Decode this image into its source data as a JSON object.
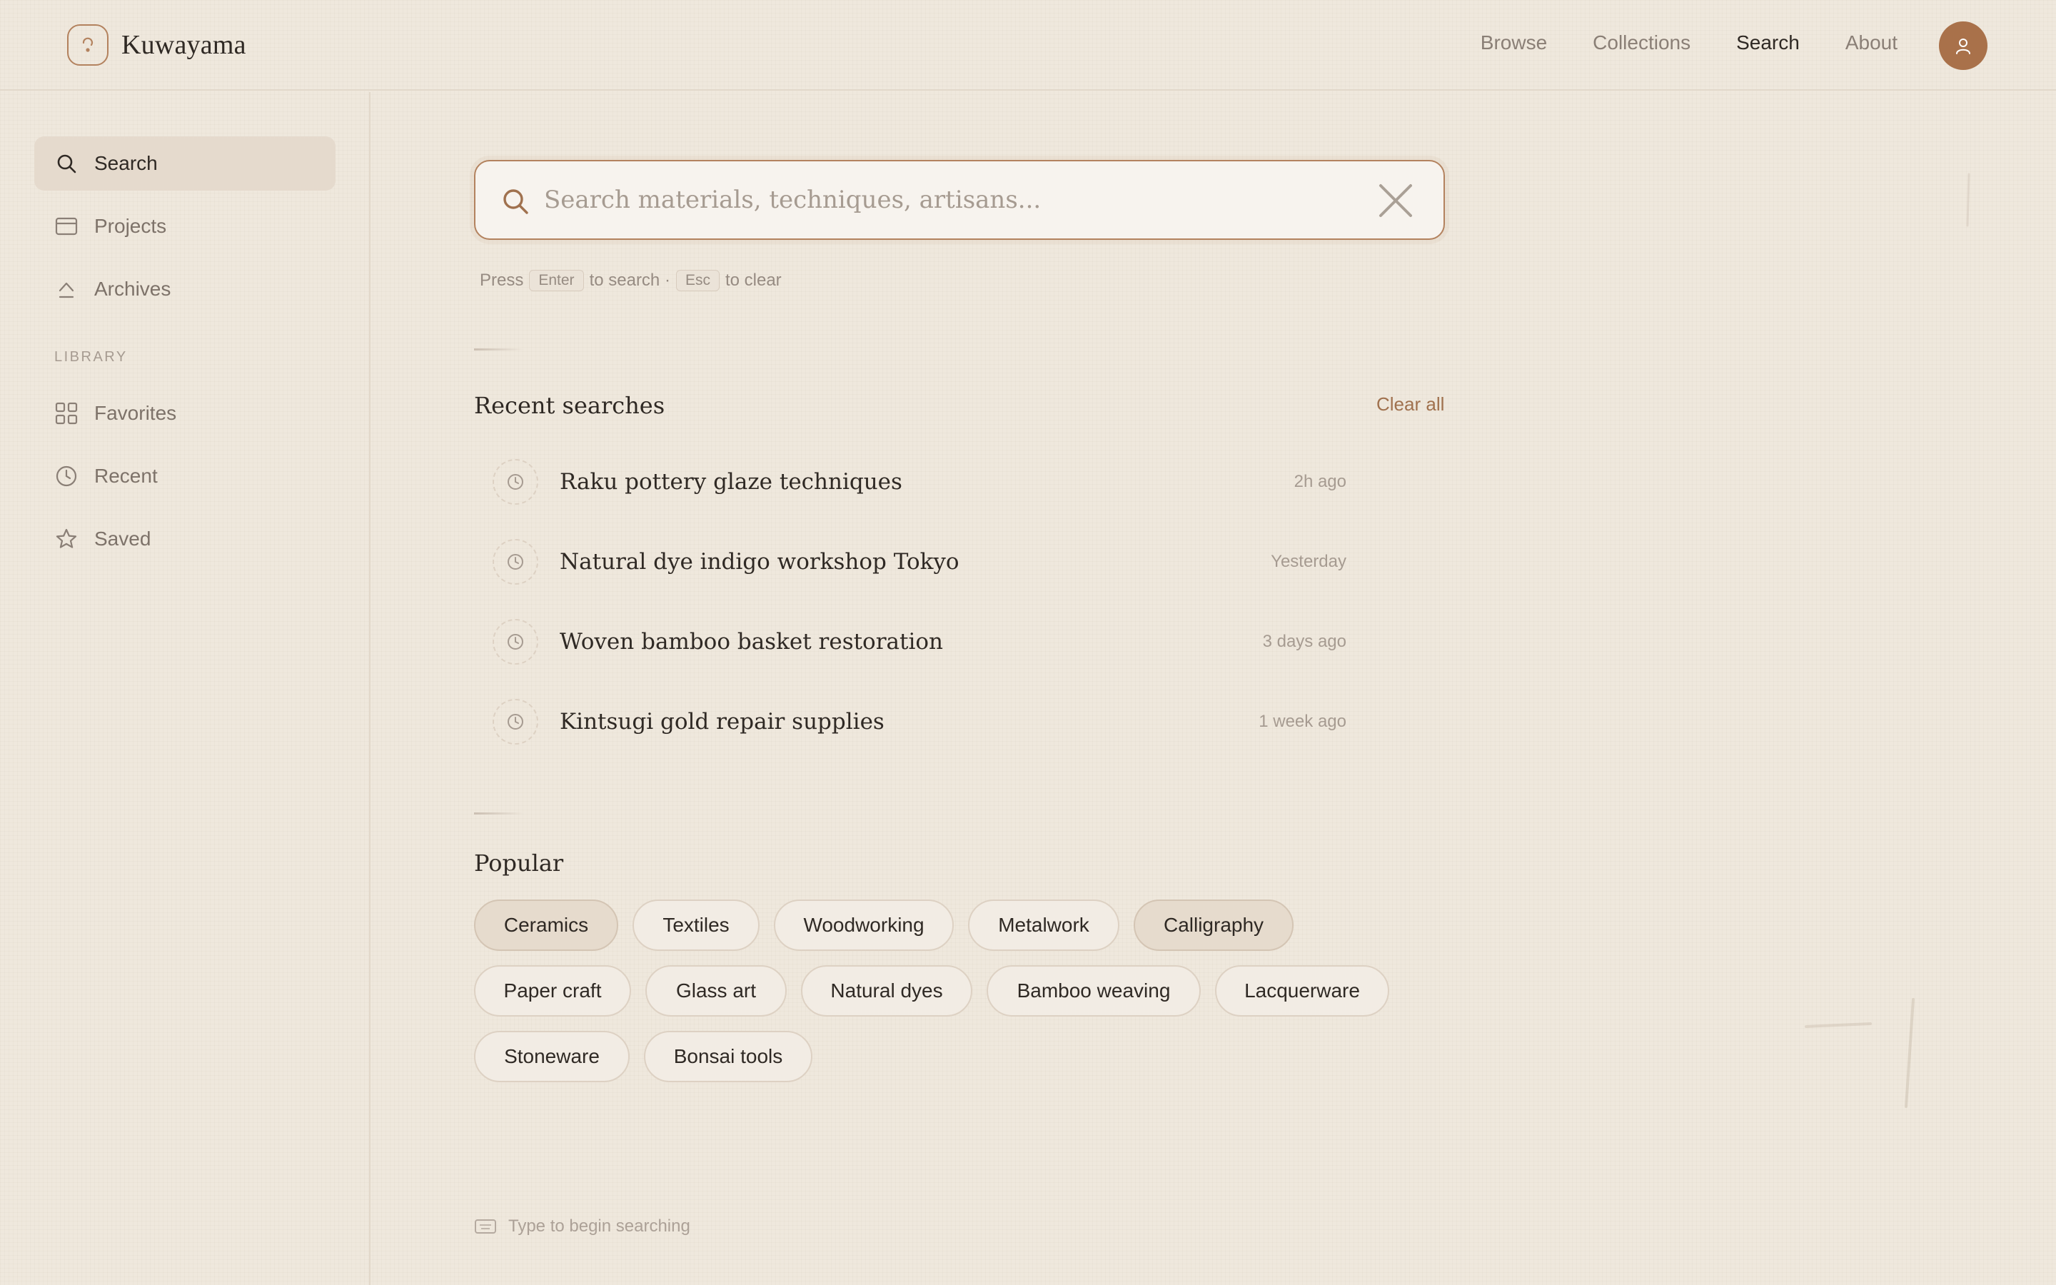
{
  "app": {
    "name": "Kuwayama"
  },
  "nav": {
    "links": [
      "Browse",
      "Collections",
      "Search",
      "About"
    ],
    "active": "Search"
  },
  "sidebar": {
    "items": [
      {
        "label": "Search",
        "icon": "search-icon",
        "active": true
      },
      {
        "label": "Projects",
        "icon": "folder-icon",
        "active": false
      },
      {
        "label": "Archives",
        "icon": "archive-icon",
        "active": false
      }
    ],
    "library_heading": "LIBRARY",
    "library_items": [
      {
        "label": "Favorites",
        "icon": "grid-icon"
      },
      {
        "label": "Recent",
        "icon": "clock-icon"
      },
      {
        "label": "Saved",
        "icon": "star-icon"
      }
    ]
  },
  "search": {
    "placeholder": "Search materials, techniques, artisans...",
    "value": "",
    "hint_press": "Press",
    "hint_enter": "Enter",
    "hint_to_search": "to search ·",
    "hint_esc": "Esc",
    "hint_to_clear": "to clear"
  },
  "recent": {
    "title": "Recent searches",
    "clear_label": "Clear all",
    "items": [
      {
        "text": "Raku pottery glaze techniques",
        "time": "2h ago"
      },
      {
        "text": "Natural dye indigo workshop Tokyo",
        "time": "Yesterday"
      },
      {
        "text": "Woven bamboo basket restoration",
        "time": "3 days ago"
      },
      {
        "text": "Kintsugi gold repair supplies",
        "time": "1 week ago"
      }
    ]
  },
  "popular": {
    "title": "Popular",
    "tags": [
      "Ceramics",
      "Textiles",
      "Woodworking",
      "Metalwork",
      "Calligraphy",
      "Paper craft",
      "Glass art",
      "Natural dyes",
      "Bamboo weaving",
      "Lacquerware",
      "Stoneware",
      "Bonsai tools"
    ]
  },
  "footer": {
    "hint": "Type to begin searching"
  },
  "colors": {
    "background": "#efe8dd",
    "accent": "#b3825e",
    "avatar": "#a9714a",
    "text": "#2f2924",
    "muted": "#8a7f76"
  }
}
